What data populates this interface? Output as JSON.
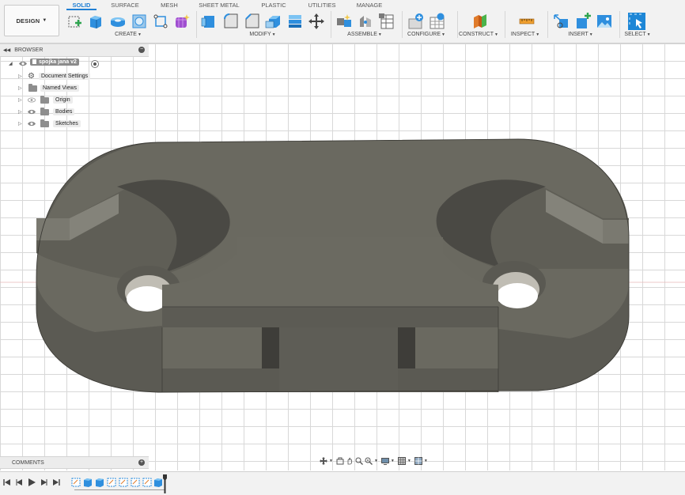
{
  "toolbar": {
    "design_label": "DESIGN",
    "workspace_tabs": [
      "SOLID",
      "SURFACE",
      "MESH",
      "SHEET METAL",
      "PLASTIC",
      "UTILITIES",
      "MANAGE"
    ],
    "active_tab": "SOLID",
    "groups": [
      "CREATE",
      "MODIFY",
      "ASSEMBLE",
      "CONFIGURE",
      "CONSTRUCT",
      "INSPECT",
      "INSERT",
      "SELECT"
    ],
    "accent_color": "#1f7fd4"
  },
  "browser": {
    "title": "BROWSER",
    "root": "spojka jana v2",
    "items": [
      "Document Settings",
      "Named Views",
      "Origin",
      "Bodies",
      "Sketches"
    ]
  },
  "comments": {
    "title": "COMMENTS"
  },
  "model": {
    "body_color": "#6d6c64",
    "top_color": "#68675f",
    "side_color": "#5a5952"
  },
  "icons": {
    "toolbar": [
      "new-component-icon",
      "extrude-icon",
      "revolve-icon",
      "hole-icon",
      "sketch-icon",
      "form-icon",
      "press-pull-icon",
      "fillet-icon",
      "chamfer-icon",
      "shell-icon",
      "combine-icon",
      "move-icon",
      "new-component-assemble-icon",
      "joint-icon",
      "table-icon",
      "configure-icon",
      "parameters-icon",
      "offset-plane-icon",
      "measure-icon",
      "insert-derive-icon",
      "insert-mesh-icon",
      "insert-image-icon",
      "select-icon"
    ],
    "navbar": [
      "orbit-icon",
      "look-at-icon",
      "pan-icon",
      "zoom-icon",
      "zoom-window-icon",
      "display-settings-icon",
      "grid-icon",
      "viewports-icon"
    ],
    "timeline": [
      "first-icon",
      "previous-icon",
      "play-icon",
      "next-icon",
      "last-icon"
    ]
  }
}
